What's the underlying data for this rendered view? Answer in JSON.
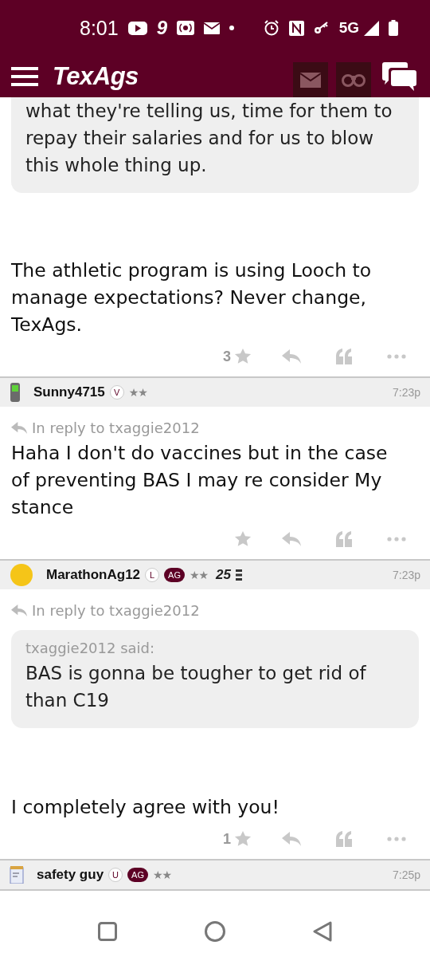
{
  "status_bar": {
    "time": "8:01",
    "app_glyph": "9",
    "network": "5G"
  },
  "app_bar": {
    "logo": "TexAgs"
  },
  "posts": [
    {
      "quote": {
        "text": "what they're telling us, time for them to repay their salaries and for us to blow this whole thing up."
      },
      "body": "The athletic program is using Looch to manage expectations? Never change, TexAgs.",
      "likes": "3"
    },
    {
      "header": {
        "avatar": {
          "kind": "phone"
        },
        "username": "Sunny4715",
        "badges": [
          {
            "text": "V",
            "kind": "outline"
          }
        ],
        "rank": "★★",
        "time": "7:23p"
      },
      "reply_to": "In reply to txaggie2012",
      "body": "Haha I don't do vaccines but in the case of preventing BAS I may re consider My stance"
    },
    {
      "header": {
        "avatar": {
          "kind": "emoji"
        },
        "username": "MarathonAg12",
        "badges": [
          {
            "text": "L",
            "kind": "outline"
          },
          {
            "text": "AG",
            "kind": "filled"
          }
        ],
        "rank": "★★",
        "tenure": "25",
        "time": "7:23p"
      },
      "reply_to": "In reply to txaggie2012",
      "quote": {
        "attribution": "txaggie2012 said:",
        "text": "BAS is gonna be tougher to get rid of than C19"
      },
      "body": "I completely agree with you!",
      "likes": "1"
    },
    {
      "header": {
        "avatar": {
          "kind": "notepad"
        },
        "username": "safety guy",
        "badges": [
          {
            "text": "U",
            "kind": "outline"
          },
          {
            "text": "AG",
            "kind": "filled"
          }
        ],
        "rank": "★★",
        "time": "7:25p"
      }
    }
  ]
}
